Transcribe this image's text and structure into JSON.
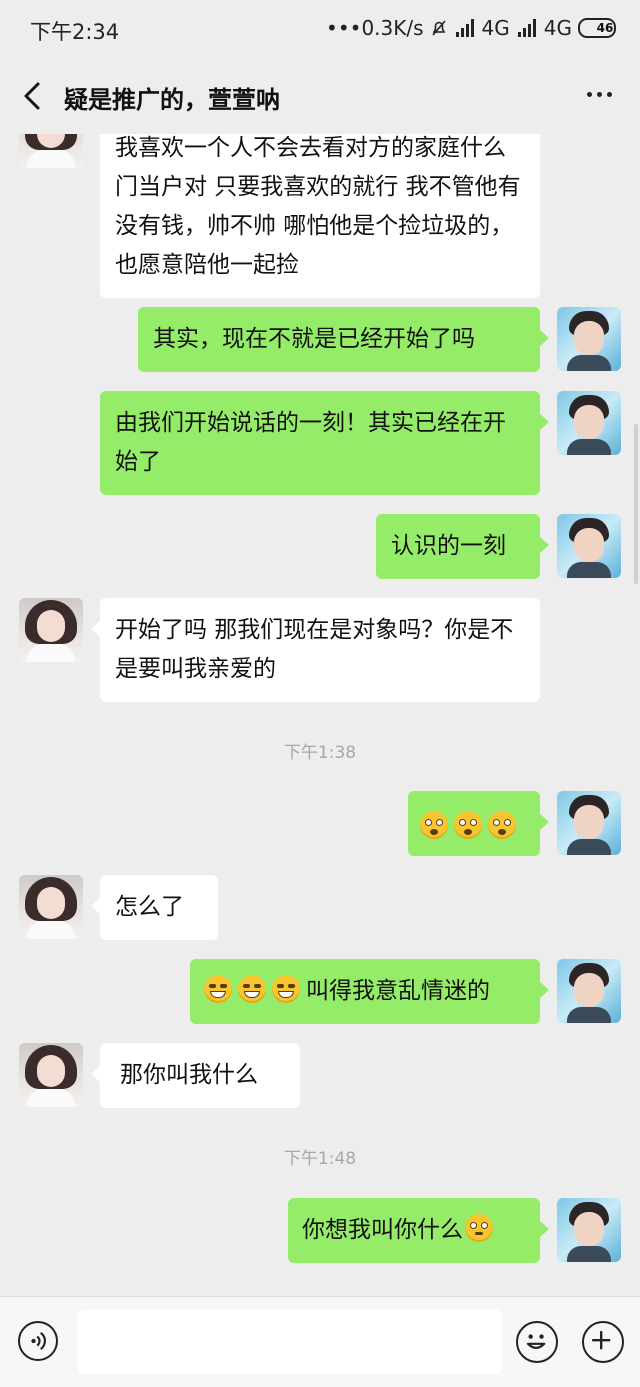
{
  "status_bar": {
    "time": "下午2:34",
    "network_speed": "•••0.3K/s",
    "signal1_label": "4G",
    "signal2_label": "4G",
    "battery": "46"
  },
  "nav": {
    "title": "疑是推广的，萱萱呐",
    "back_icon": "chevron-left-icon",
    "more_icon": "more-dots-icon"
  },
  "messages": [
    {
      "side": "in",
      "text": "我喜欢一个人不会去看对方的家庭什么门当户对 只要我喜欢的就行 我不管他有没有钱，帅不帅 哪怕他是个捡垃圾的，也愿意陪他一起捡"
    },
    {
      "side": "out",
      "text": "其实，现在不就是已经开始了吗"
    },
    {
      "side": "out",
      "text": "由我们开始说话的一刻！其实已经在开始了"
    },
    {
      "side": "out",
      "text": "认识的一刻"
    },
    {
      "side": "in",
      "text": "开始了吗 那我们现在是对象吗？你是不是要叫我亲爱的"
    },
    {
      "side": "out",
      "text": "",
      "emojis": [
        "stare",
        "stare",
        "stare"
      ]
    },
    {
      "side": "in",
      "text": "怎么了"
    },
    {
      "side": "out",
      "text": "叫得我意乱情迷的",
      "emojis": [
        "grin",
        "grin",
        "grin"
      ]
    },
    {
      "side": "in",
      "text": "那你叫我什么"
    },
    {
      "side": "out",
      "text": "你想我叫你什么",
      "emojis_after": [
        "shy"
      ]
    }
  ],
  "timestamps": [
    "下午1:38",
    "下午1:48"
  ],
  "input_bar": {
    "voice_icon": "voice-icon",
    "emoji_icon": "emoji-icon",
    "plus_icon": "plus-icon",
    "placeholder": ""
  },
  "colors": {
    "background": "#ededed",
    "outgoing_bubble": "#95ec69",
    "incoming_bubble": "#ffffff"
  }
}
